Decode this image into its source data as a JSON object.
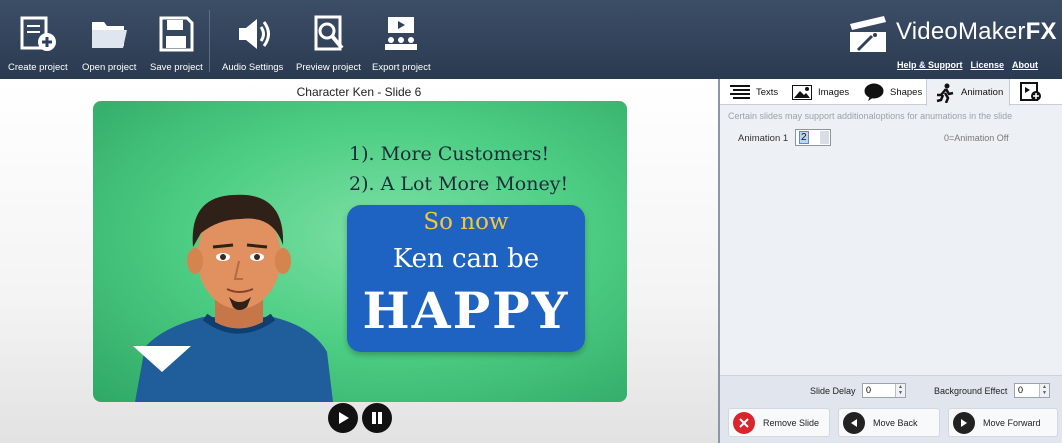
{
  "toolbar": {
    "buttons": [
      {
        "label": "Create project",
        "icon": "create-project-icon"
      },
      {
        "label": "Open project",
        "icon": "folder-icon"
      },
      {
        "label": "Save project",
        "icon": "floppy-icon"
      },
      {
        "label": "Audio Settings",
        "icon": "speaker-icon"
      },
      {
        "label": "Preview project",
        "icon": "magnifier-icon"
      },
      {
        "label": "Export project",
        "icon": "export-icon"
      }
    ]
  },
  "brand": {
    "name_regular": "VideoMaker",
    "name_bold": "FX"
  },
  "links": {
    "help": "Help & Support",
    "license": "License",
    "about": "About"
  },
  "preview": {
    "slide_title": "Character Ken - Slide 6",
    "line1": "1). More Customers!",
    "line2": "2). A Lot More Money!",
    "box_line1": "So now",
    "box_line2": "Ken can be",
    "box_line3": "HAPPY"
  },
  "panel": {
    "tabs": [
      {
        "label": "Texts",
        "icon": "text-lines-icon"
      },
      {
        "label": "Images",
        "icon": "image-icon"
      },
      {
        "label": "Shapes",
        "icon": "speech-bubble-icon"
      },
      {
        "label": "Animation",
        "icon": "running-figure-icon"
      },
      {
        "label": "",
        "icon": "add-slide-icon"
      }
    ],
    "info": "Certain slides may support additionaloptions for anumations in the slide",
    "animation_label": "Animation 1",
    "animation_value": "2",
    "animation_hint": "0=Animation Off",
    "slide_delay_label": "Slide Delay",
    "slide_delay_value": "0",
    "bg_effect_label": "Background Effect",
    "bg_effect_value": "0",
    "remove_label": "Remove Slide",
    "back_label": "Move Back",
    "forward_label": "Move Forward"
  },
  "colors": {
    "toolbar": "#2f405a",
    "remove": "#d9252b",
    "nav": "#222222",
    "canvas": "#4fcf85",
    "box": "#1e63c2"
  }
}
